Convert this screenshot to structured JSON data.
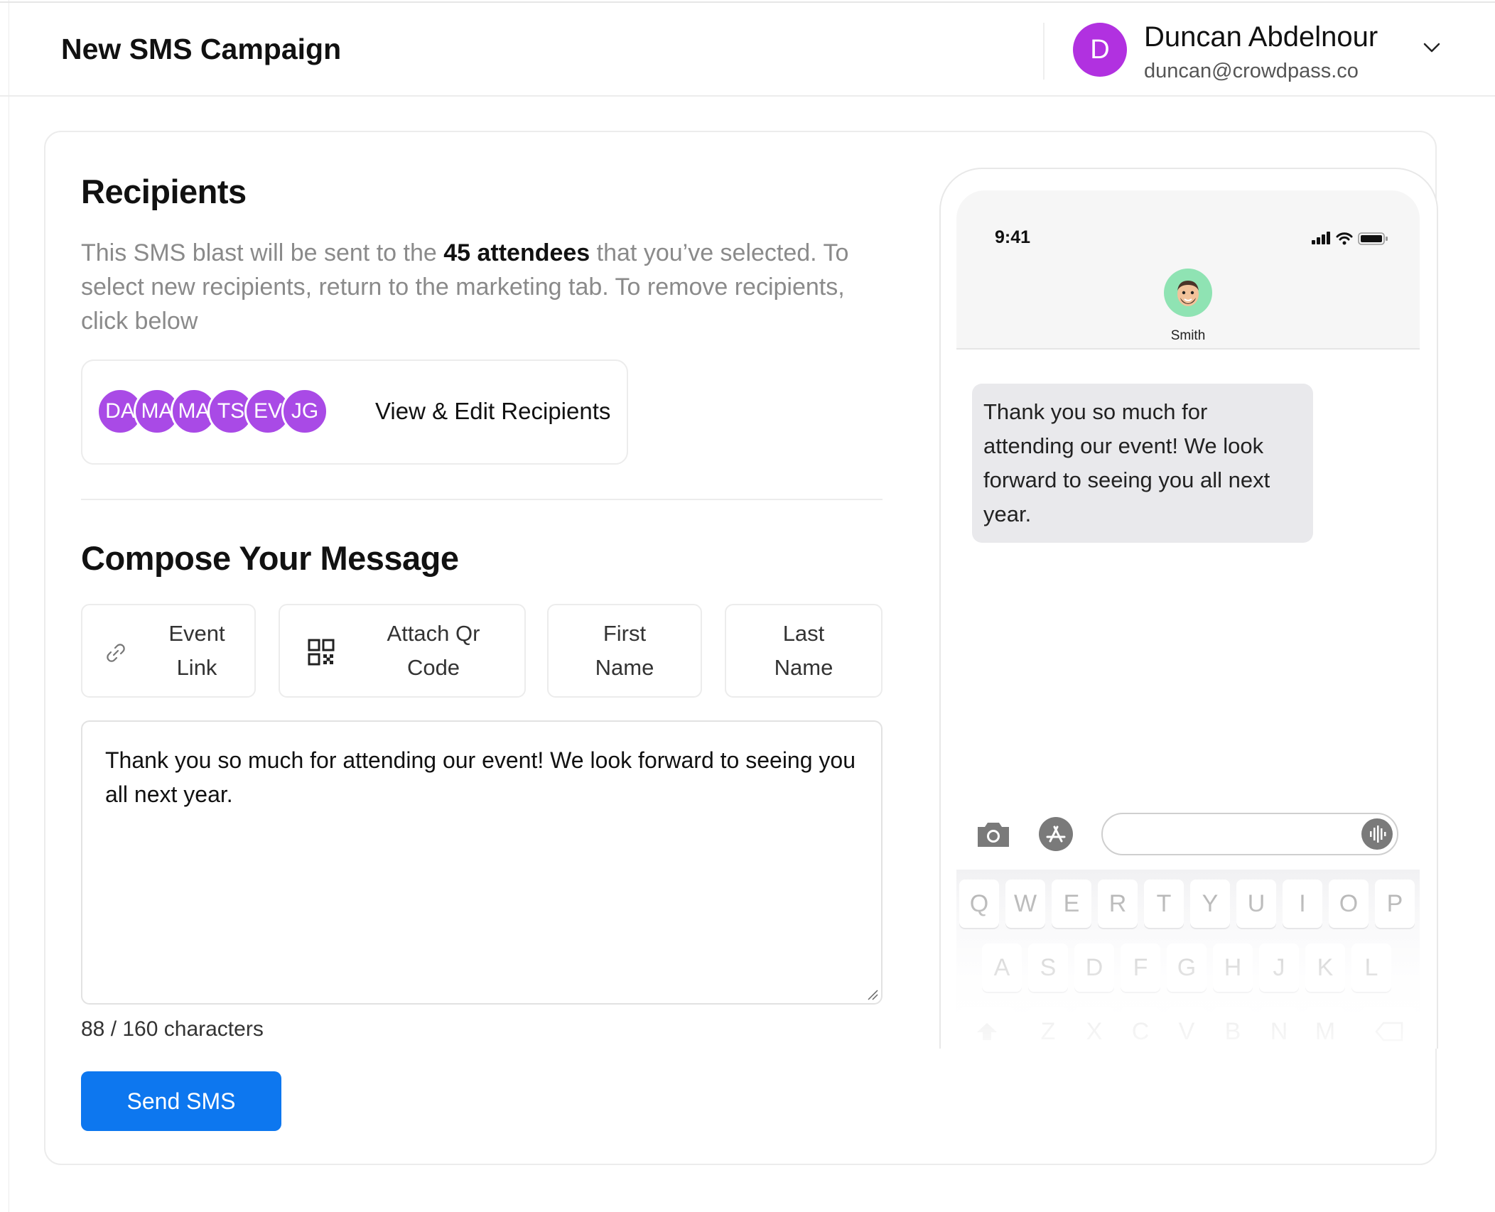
{
  "header": {
    "title": "New SMS Campaign",
    "user": {
      "initial": "D",
      "name": "Duncan Abdelnour",
      "email": "duncan@crowdpass.co"
    }
  },
  "recipients": {
    "title": "Recipients",
    "description_pre": "This SMS blast will be sent to the ",
    "count_text": "45 attendees",
    "description_post": " that you’ve selected. To select new recipients, return to the marketing tab. To remove recipients, click below",
    "avatars": [
      "DA",
      "MA",
      "MA",
      "TS",
      "EV",
      "JG"
    ],
    "edit_link": "View & Edit Recipients"
  },
  "compose": {
    "title": "Compose Your Message",
    "tags": {
      "event_link": "Event Link",
      "attach_qr": "Attach Qr Code",
      "first_name": "First Name",
      "last_name": "Last Name"
    },
    "message": "Thank you so much for attending our event! We look forward to seeing you all next year.",
    "char_count": "88 / 160 characters",
    "send_label": "Send SMS"
  },
  "preview": {
    "time": "9:41",
    "contact_name": "Smith",
    "bubble_text": "Thank you so much for attending our event! We look forward to seeing you all next year.",
    "keyboard": {
      "row1": [
        "Q",
        "W",
        "E",
        "R",
        "T",
        "Y",
        "U",
        "I",
        "O",
        "P"
      ],
      "row2": [
        "A",
        "S",
        "D",
        "F",
        "G",
        "H",
        "J",
        "K",
        "L"
      ],
      "row3": [
        "Z",
        "X",
        "C",
        "V",
        "B",
        "N",
        "M"
      ]
    }
  },
  "colors": {
    "accent": "#0d77ef",
    "avatar": "#b131e0",
    "recipient_avatar": "#a94ae6",
    "bubble": "#e9e9ec"
  }
}
